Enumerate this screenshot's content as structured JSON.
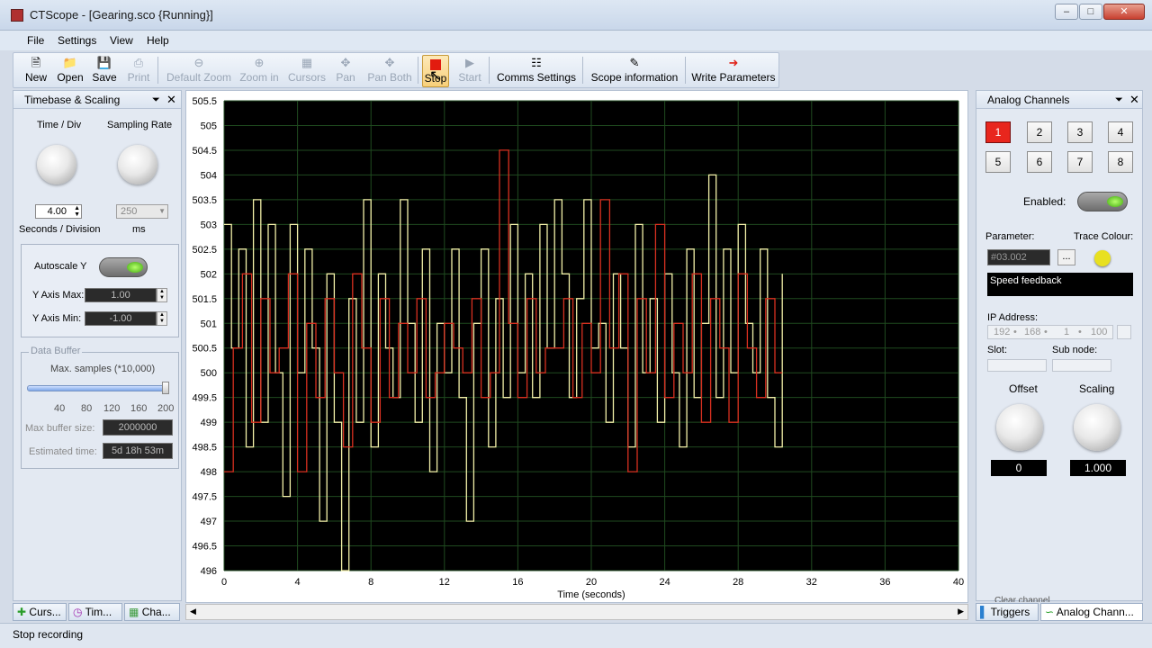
{
  "window": {
    "title": "CTScope - [Gearing.sco {Running}]"
  },
  "menu": [
    "File",
    "Settings",
    "View",
    "Help"
  ],
  "toolbar": {
    "new": "New",
    "open": "Open",
    "save": "Save",
    "print": "Print",
    "default_zoom": "Default Zoom",
    "zoom_in": "Zoom in",
    "cursors": "Cursors",
    "pan": "Pan",
    "pan_both": "Pan Both",
    "stop": "Stop",
    "start": "Start",
    "comms_settings": "Comms Settings",
    "scope_information": "Scope information",
    "write_parameters": "Write Parameters"
  },
  "timebase": {
    "header": "Timebase & Scaling",
    "time_div_label": "Time / Div",
    "sampling_rate_label": "Sampling Rate",
    "time_div_value": "4.00",
    "sampling_rate_value": "250",
    "seconds_per_div_label": "Seconds / Division",
    "ms_label": "ms",
    "autoscale_label": "Autoscale Y",
    "y_max_label": "Y Axis Max:",
    "y_max_value": "1.00",
    "y_min_label": "Y Axis Min:",
    "y_min_value": "-1.00",
    "data_buffer_label": "Data Buffer",
    "max_samples_label": "Max. samples (*10,000)",
    "slider_ticks": [
      "40",
      "80",
      "120",
      "160",
      "200"
    ],
    "max_buffer_label": "Max buffer size:",
    "max_buffer_value": "2000000",
    "estimated_time_label": "Estimated time:",
    "estimated_time_value": "5d 18h 53m"
  },
  "bottom_tabs_left": [
    "Curs...",
    "Tim...",
    "Cha..."
  ],
  "analog": {
    "header": "Analog Channels",
    "channels": [
      "1",
      "2",
      "3",
      "4",
      "5",
      "6",
      "7",
      "8"
    ],
    "enabled_label": "Enabled:",
    "parameter_label": "Parameter:",
    "trace_colour_label": "Trace Colour:",
    "parameter_value": "#03.002",
    "browse_label": "...",
    "description": "Speed feedback",
    "ip_label": "IP Address:",
    "ip_parts": [
      "192",
      "168",
      "1",
      "100"
    ],
    "slot_label": "Slot:",
    "subnode_label": "Sub node:",
    "offset_label": "Offset",
    "scaling_label": "Scaling",
    "offset_value": "0",
    "scaling_value": "1.000",
    "clear_channel": "Clear channel",
    "trace_colour": "#e8e020"
  },
  "bottom_tabs_right": [
    "Triggers",
    "Analog Chann..."
  ],
  "status": {
    "text": "Stop recording"
  },
  "chart_data": {
    "type": "line",
    "xlabel": "Time (seconds)",
    "ylabel": "",
    "xlim": [
      0,
      40
    ],
    "ylim": [
      496,
      505.5
    ],
    "xticks": [
      0,
      4,
      8,
      12,
      16,
      20,
      24,
      28,
      32,
      36,
      40
    ],
    "yticks": [
      496,
      496.5,
      497,
      497.5,
      498,
      498.5,
      499,
      499.5,
      500,
      500.5,
      501,
      501.5,
      502,
      502.5,
      503,
      503.5,
      504,
      504.5,
      505,
      505.5
    ],
    "background": "#000000",
    "grid_color": "#1f4a1f",
    "series": [
      {
        "color": "#f2f0a8",
        "x": [
          0.0,
          0.4,
          0.8,
          1.2,
          1.6,
          2.0,
          2.4,
          2.8,
          3.2,
          3.6,
          4.0,
          4.4,
          4.8,
          5.2,
          5.6,
          6.0,
          6.4,
          6.8,
          7.2,
          7.6,
          8.0,
          8.4,
          8.8,
          9.2,
          9.6,
          10.0,
          10.4,
          10.8,
          11.2,
          11.6,
          12.0,
          12.4,
          12.8,
          13.2,
          13.6,
          14.0,
          14.4,
          14.8,
          15.2,
          15.6,
          16.0,
          16.4,
          16.8,
          17.2,
          17.6,
          18.0,
          18.4,
          18.8,
          19.2,
          19.6,
          20.0,
          20.4,
          20.8,
          21.2,
          21.6,
          22.0,
          22.4,
          22.8,
          23.2,
          23.6,
          24.0,
          24.4,
          24.8,
          25.2,
          25.6,
          26.0,
          26.4,
          26.8,
          27.2,
          27.6,
          28.0,
          28.4,
          28.8,
          29.2,
          29.6,
          30.0,
          30.4
        ],
        "y": [
          503.0,
          500.5,
          502.5,
          498.5,
          503.5,
          499.0,
          503.0,
          500.0,
          497.5,
          503.0,
          500.0,
          502.5,
          500.5,
          497.0,
          502.0,
          499.0,
          496.0,
          501.5,
          499.0,
          503.5,
          498.5,
          502.0,
          500.5,
          499.5,
          503.5,
          501.0,
          499.0,
          502.5,
          498.0,
          501.0,
          500.0,
          502.5,
          499.5,
          497.0,
          501.0,
          502.5,
          498.5,
          501.5,
          499.5,
          503.0,
          500.0,
          502.0,
          499.5,
          503.0,
          500.5,
          503.5,
          502.0,
          499.5,
          501.5,
          503.5,
          500.5,
          501.0,
          499.0,
          502.0,
          500.5,
          498.5,
          503.0,
          500.0,
          501.5,
          499.0,
          502.0,
          500.0,
          498.5,
          502.5,
          499.5,
          501.0,
          504.0,
          499.5,
          502.5,
          500.0,
          503.0,
          501.0,
          500.0,
          502.5,
          499.5,
          498.5,
          502.0
        ]
      },
      {
        "color": "#d83020",
        "x": [
          0.0,
          0.5,
          1.0,
          1.5,
          2.0,
          2.5,
          3.0,
          3.5,
          4.0,
          4.5,
          5.0,
          5.5,
          6.0,
          6.5,
          7.0,
          7.5,
          8.0,
          8.5,
          9.0,
          9.5,
          10.0,
          10.5,
          11.0,
          11.5,
          12.0,
          12.5,
          13.0,
          13.5,
          14.0,
          14.5,
          15.0,
          15.5,
          16.0,
          16.5,
          17.0,
          17.5,
          18.0,
          18.5,
          19.0,
          19.5,
          20.0,
          20.5,
          21.0,
          21.5,
          22.0,
          22.5,
          23.0,
          23.5,
          24.0,
          24.5,
          25.0,
          25.5,
          26.0,
          26.5,
          27.0,
          27.5,
          28.0,
          28.5,
          29.0,
          29.5,
          30.0,
          30.4
        ],
        "y": [
          498.0,
          500.5,
          502.0,
          499.0,
          501.5,
          500.0,
          500.5,
          502.0,
          498.0,
          501.0,
          499.5,
          501.5,
          500.0,
          498.5,
          502.0,
          500.5,
          499.0,
          501.5,
          499.5,
          501.0,
          500.0,
          501.5,
          499.5,
          500.0,
          501.0,
          500.5,
          500.0,
          501.5,
          499.5,
          500.0,
          504.5,
          501.0,
          499.5,
          501.5,
          500.0,
          500.5,
          500.5,
          501.5,
          499.5,
          501.0,
          500.0,
          503.5,
          500.5,
          502.0,
          498.0,
          501.5,
          500.0,
          503.0,
          499.5,
          501.0,
          500.0,
          502.0,
          499.0,
          501.5,
          500.5,
          499.0,
          502.0,
          500.5,
          499.5,
          501.5,
          500.0,
          500.0
        ]
      }
    ]
  }
}
